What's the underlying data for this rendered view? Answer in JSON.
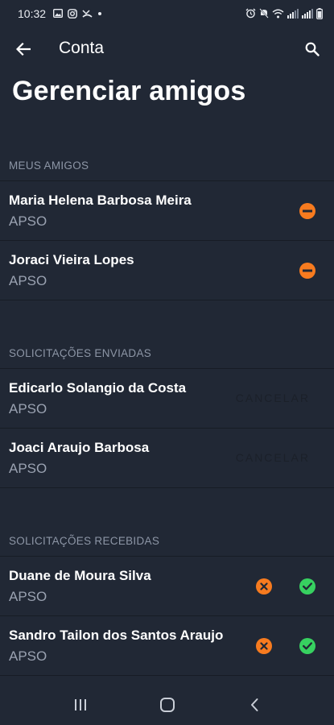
{
  "status_bar": {
    "time": "10:32",
    "left_icons": [
      "image-icon",
      "instagram-icon",
      "missed-call-icon",
      "dot-icon"
    ],
    "right_icons": [
      "alarm-icon",
      "mute-icon",
      "wifi-icon",
      "signal-icon",
      "signal-icon",
      "battery-icon"
    ]
  },
  "app_bar": {
    "title": "Conta"
  },
  "page": {
    "title": "Gerenciar amigos"
  },
  "sections": {
    "friends": {
      "header": "MEUS AMIGOS",
      "items": [
        {
          "name": "Maria Helena Barbosa Meira",
          "org": "APSO"
        },
        {
          "name": "Joraci Vieira Lopes",
          "org": "APSO"
        }
      ]
    },
    "sent": {
      "header": "SOLICITAÇÕES ENVIADAS",
      "cancel_label": "CANCELAR",
      "items": [
        {
          "name": "Edicarlo Solangio da Costa",
          "org": "APSO"
        },
        {
          "name": "Joaci Araujo Barbosa",
          "org": "APSO"
        }
      ]
    },
    "received": {
      "header": "SOLICITAÇÕES RECEBIDAS",
      "items": [
        {
          "name": "Duane de Moura Silva",
          "org": "APSO"
        },
        {
          "name": "Sandro Tailon dos Santos Araujo",
          "org": "APSO"
        }
      ]
    }
  },
  "colors": {
    "background": "#212835",
    "remove": "#f77b1f",
    "accept": "#37d160"
  },
  "nav_bar": {
    "icons": [
      "recent-apps-icon",
      "home-icon",
      "back-nav-icon"
    ]
  }
}
